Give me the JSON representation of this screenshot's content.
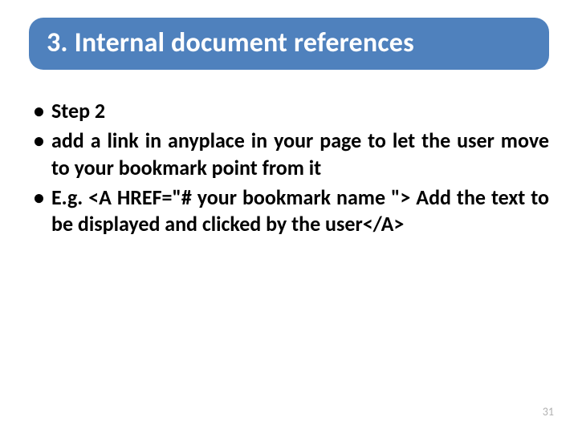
{
  "title": "3. Internal document references",
  "bullets": [
    "Step 2",
    "add a link in anyplace in your page to let the user move to your bookmark point from it",
    "E.g. <A HREF=\"# your bookmark name \"> Add the text to be displayed and clicked by the user</A>"
  ],
  "page_number": "31",
  "colors": {
    "title_bg": "#4f81bd",
    "title_text": "#ffffff",
    "page_num": "#b0b0b0"
  }
}
